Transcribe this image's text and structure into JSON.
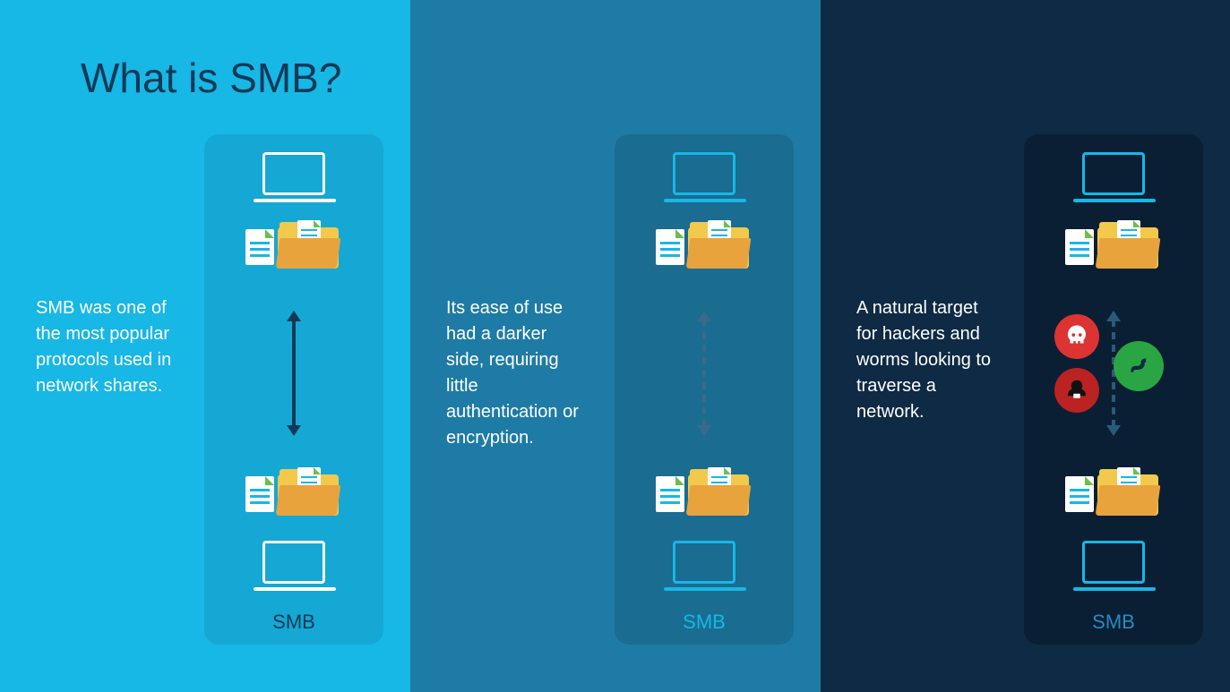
{
  "title": "What is SMB?",
  "panels": [
    {
      "text": "SMB was one of the most popular protocols used in network shares.",
      "card_label": "SMB",
      "arrow_style": "solid"
    },
    {
      "text": "Its ease of use had a darker side, requiring little authentication or encryption.",
      "card_label": "SMB",
      "arrow_style": "dashed"
    },
    {
      "text": "A natural target for hackers and worms looking to traverse a network.",
      "card_label": "SMB",
      "arrow_style": "dashed",
      "threats": [
        "skull-icon",
        "hacker-icon",
        "worm-icon"
      ]
    }
  ],
  "colors": {
    "panel1": "#17b7e6",
    "panel2": "#1e7ba6",
    "panel3": "#0e2a44",
    "accent": "#17b7e6",
    "dark_text": "#0e3a57"
  }
}
